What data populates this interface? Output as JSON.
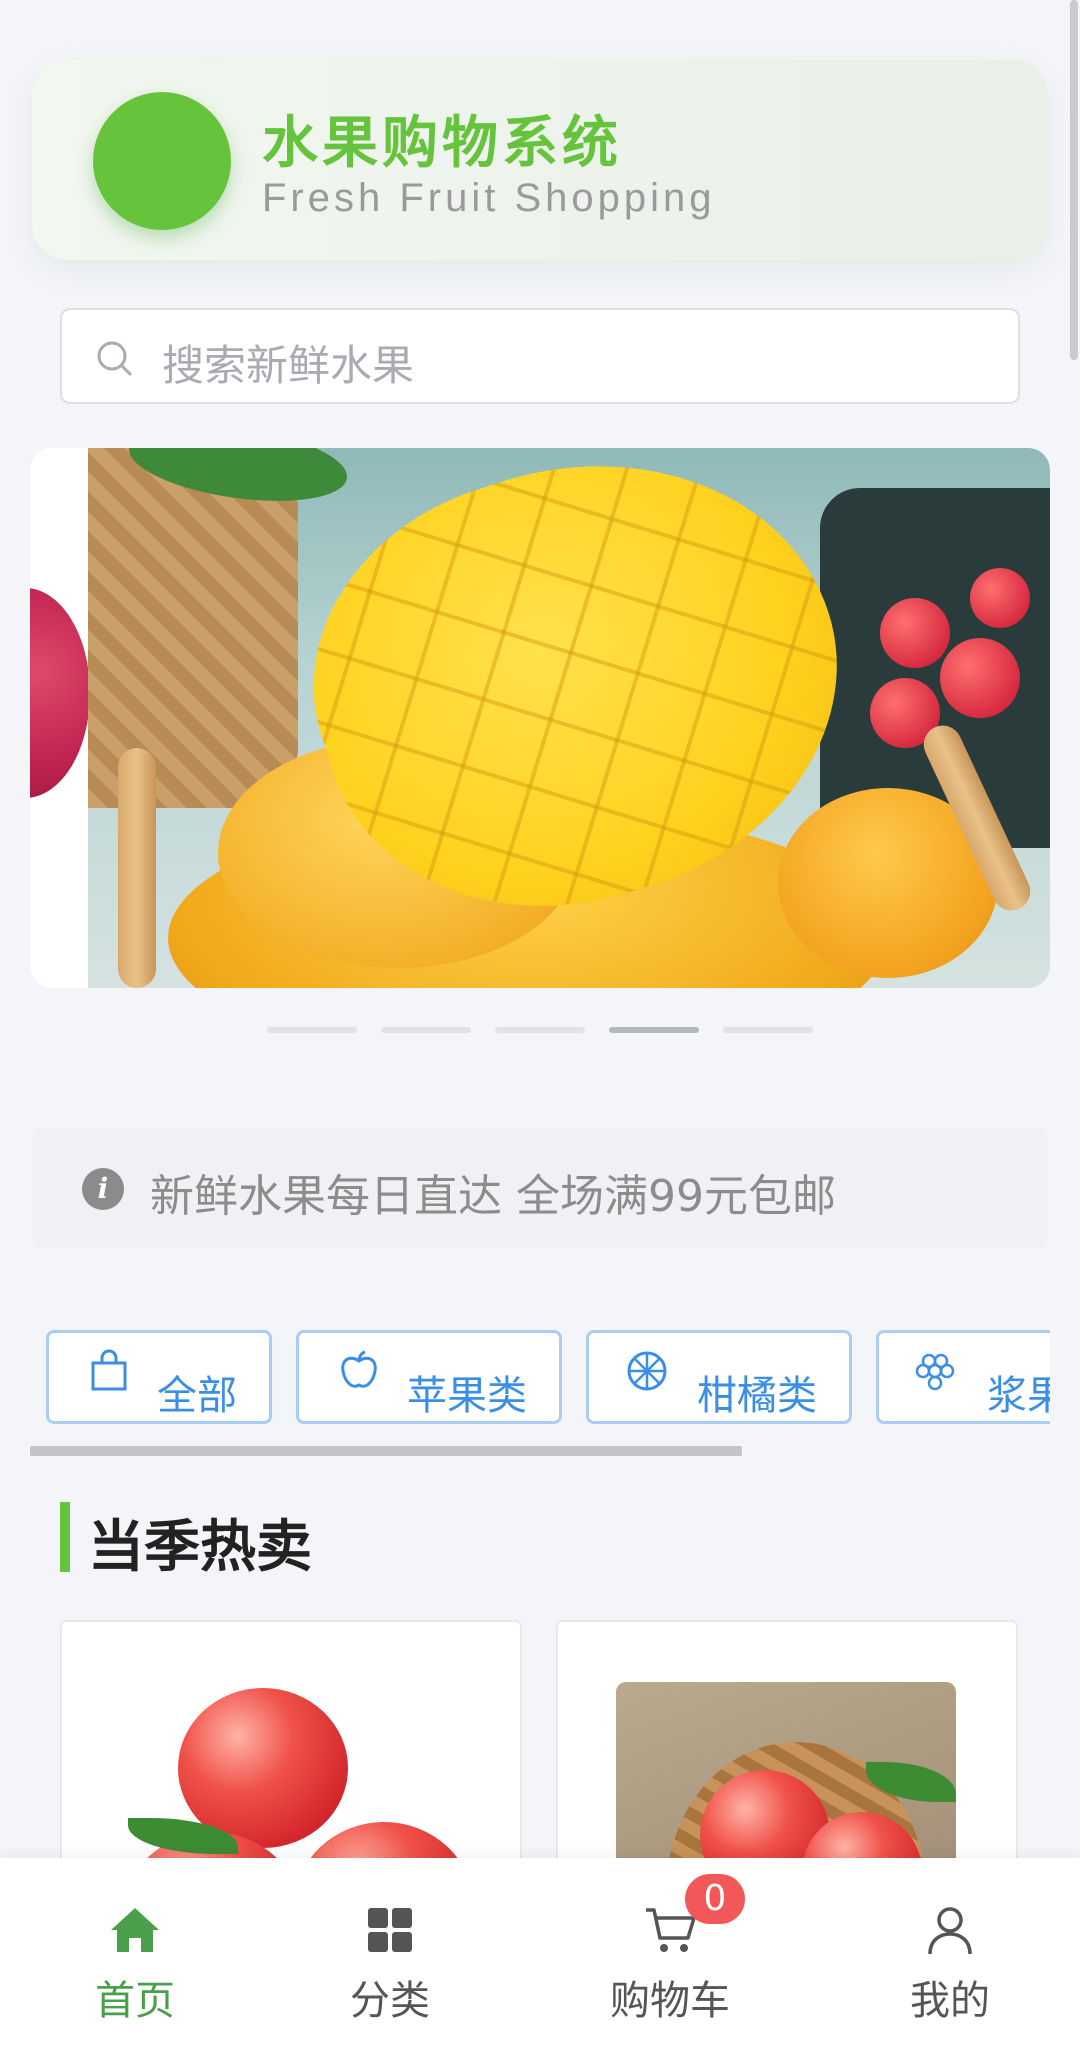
{
  "header": {
    "title": "水果购物系统",
    "subtitle": "Fresh Fruit Shopping",
    "accent_color": "#66c33c"
  },
  "search": {
    "placeholder": "搜索新鲜水果",
    "icon": "search-icon"
  },
  "carousel": {
    "slide_count": 5,
    "active_index": 3
  },
  "notice": {
    "icon": "info-icon",
    "text": "新鲜水果每日直达 全场满99元包邮"
  },
  "categories": [
    {
      "label": "全部",
      "icon": "shopping-bag-icon"
    },
    {
      "label": "苹果类",
      "icon": "apple-icon"
    },
    {
      "label": "柑橘类",
      "icon": "citrus-icon"
    },
    {
      "label": "浆果",
      "icon": "grape-icon"
    }
  ],
  "section": {
    "title": "当季热卖"
  },
  "tabbar": {
    "items": [
      {
        "label": "首页",
        "icon": "home-icon",
        "active": true
      },
      {
        "label": "分类",
        "icon": "category-icon",
        "active": false
      },
      {
        "label": "购物车",
        "icon": "cart-icon",
        "active": false
      },
      {
        "label": "我的",
        "icon": "user-icon",
        "active": false
      }
    ],
    "cart_badge": "0",
    "active_color": "#4aa04a"
  }
}
